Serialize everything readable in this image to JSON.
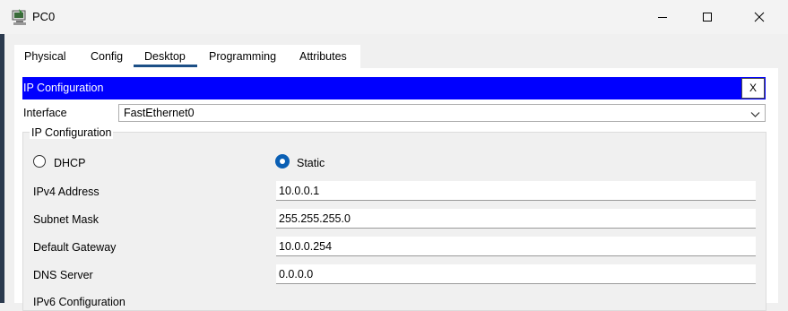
{
  "window": {
    "title": "PC0"
  },
  "tabs": [
    "Physical",
    "Config",
    "Desktop",
    "Programming",
    "Attributes"
  ],
  "active_tab": "Desktop",
  "panel": {
    "header_title": "IP Configuration",
    "close_label": "X"
  },
  "interface": {
    "label": "Interface",
    "value": "FastEthernet0"
  },
  "ipv4_group": {
    "title": "IP Configuration",
    "dhcp_label": "DHCP",
    "static_label": "Static",
    "selected_mode": "Static",
    "fields": [
      {
        "label": "IPv4 Address",
        "value": "10.0.0.1"
      },
      {
        "label": "Subnet Mask",
        "value": "255.255.255.0"
      },
      {
        "label": "Default Gateway",
        "value": "10.0.0.254"
      },
      {
        "label": "DNS Server",
        "value": "0.0.0.0"
      }
    ]
  },
  "ipv6_group": {
    "title": "IPv6 Configuration"
  },
  "colors": {
    "header_bg": "#0000ff",
    "tab_active": "#1c4f86",
    "radio_selected": "#0a5fb4"
  }
}
